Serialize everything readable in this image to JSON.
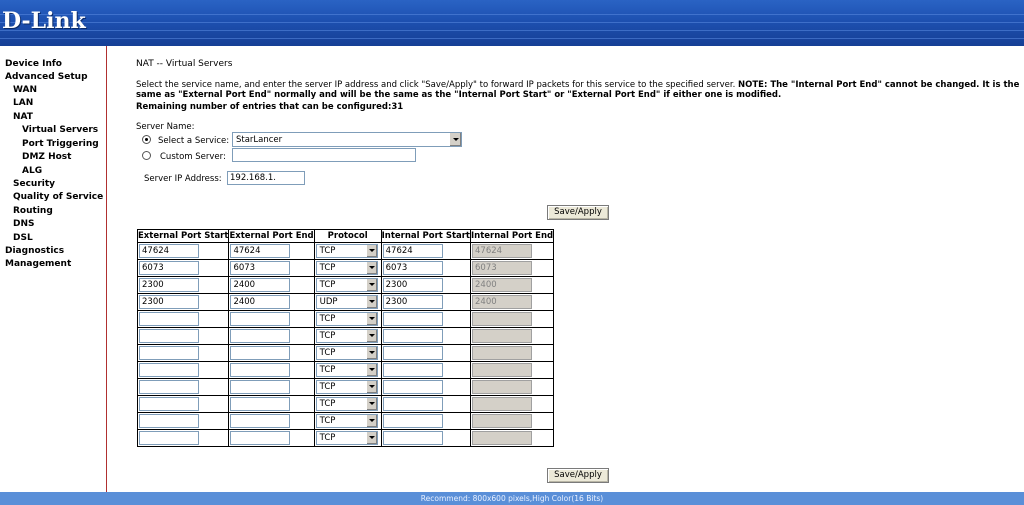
{
  "header": {
    "logo_text": "D-Link"
  },
  "sidebar": {
    "items": [
      {
        "label": "Device Info"
      },
      {
        "label": "Advanced Setup"
      },
      {
        "label": "WAN"
      },
      {
        "label": "LAN"
      },
      {
        "label": "NAT"
      },
      {
        "label": "Virtual Servers"
      },
      {
        "label": "Port Triggering"
      },
      {
        "label": "DMZ Host"
      },
      {
        "label": "ALG"
      },
      {
        "label": "Security"
      },
      {
        "label": "Quality of Service"
      },
      {
        "label": "Routing"
      },
      {
        "label": "DNS"
      },
      {
        "label": "DSL"
      },
      {
        "label": "Diagnostics"
      },
      {
        "label": "Management"
      }
    ]
  },
  "main": {
    "title": "NAT -- Virtual Servers",
    "desc_plain": "Select the service name, and enter the server IP address and click \"Save/Apply\" to forward IP packets for this service to the specified server.",
    "desc_bold": "NOTE: The \"Internal Port End\" cannot be changed. It is the same as \"External Port End\" normally and will be the same as the \"Internal Port Start\" or \"External Port End\" if either one is modified.",
    "remaining": "Remaining number of entries that can be configured:31",
    "server_name_label": "Server Name:",
    "select_service_label": "Select a Service:",
    "select_service_value": "StarLancer",
    "select_service_checked": true,
    "custom_server_label": "Custom Server:",
    "custom_server_value": "",
    "server_ip_label": "Server IP Address:",
    "server_ip_value": "192.168.1.",
    "save_apply_label": "Save/Apply"
  },
  "table": {
    "headers": [
      "External Port Start",
      "External Port End",
      "Protocol",
      "Internal Port Start",
      "Internal Port End"
    ],
    "rows": [
      [
        "47624",
        "47624",
        "TCP",
        "47624",
        "47624"
      ],
      [
        "6073",
        "6073",
        "TCP",
        "6073",
        "6073"
      ],
      [
        "2300",
        "2400",
        "TCP",
        "2300",
        "2400"
      ],
      [
        "2300",
        "2400",
        "UDP",
        "2300",
        "2400"
      ],
      [
        "",
        "",
        "TCP",
        "",
        ""
      ],
      [
        "",
        "",
        "TCP",
        "",
        ""
      ],
      [
        "",
        "",
        "TCP",
        "",
        ""
      ],
      [
        "",
        "",
        "TCP",
        "",
        ""
      ],
      [
        "",
        "",
        "TCP",
        "",
        ""
      ],
      [
        "",
        "",
        "TCP",
        "",
        ""
      ],
      [
        "",
        "",
        "TCP",
        "",
        ""
      ],
      [
        "",
        "",
        "TCP",
        "",
        ""
      ]
    ]
  },
  "footer": {
    "text": "Recommend: 800x600 pixels,High Color(16 Bits)"
  }
}
